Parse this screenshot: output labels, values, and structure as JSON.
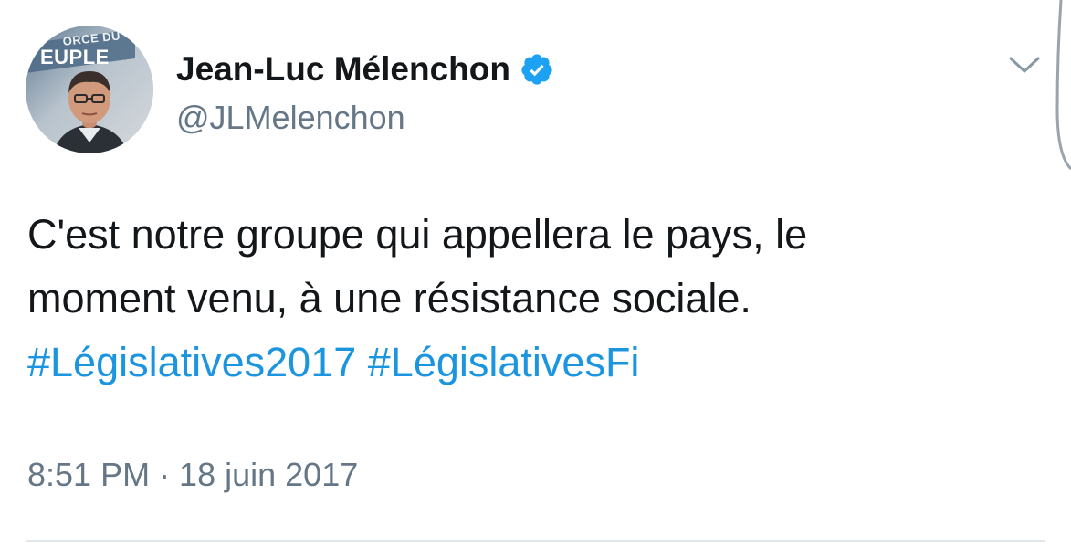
{
  "tweet": {
    "author": {
      "display_name": "Jean-Luc Mélenchon",
      "handle": "@JLMelenchon",
      "verified": true,
      "avatar_text_top": "ORCE DU",
      "avatar_text_main": "EUPLE"
    },
    "text_lines": [
      "C'est notre groupe qui appellera le pays, le",
      "moment venu, à une résistance sociale."
    ],
    "hashtags": [
      "#Législatives2017",
      "#LégislativesFi"
    ],
    "timestamp": "8:51 PM · 18 juin 2017"
  },
  "icons": {
    "verified": "verified-badge-icon",
    "menu": "chevron-down-icon"
  },
  "colors": {
    "text": "#14171a",
    "secondary": "#657786",
    "link": "#1b95e0",
    "verified": "#1da1f2",
    "divider": "#e1e8ed"
  }
}
